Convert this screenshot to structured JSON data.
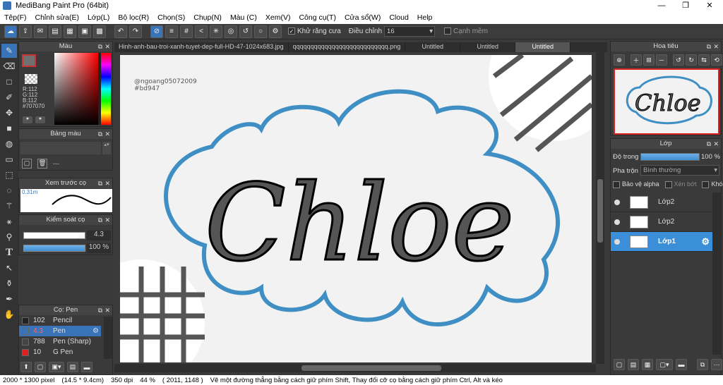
{
  "app": {
    "title": "MediBang Paint Pro (64bit)",
    "minimize": "—",
    "maximize": "❐",
    "close": "✕"
  },
  "menu": [
    "Tệp(F)",
    "Chỉnh sửa(E)",
    "Lớp(L)",
    "Bộ lọc(R)",
    "Chọn(S)",
    "Chụp(N)",
    "Màu (C)",
    "Xem(V)",
    "Công cụ(T)",
    "Cửa sổ(W)",
    "Cloud",
    "Help"
  ],
  "toolbar": {
    "antialias_label": "Khử răng cưa",
    "correction_label": "Điều chỉnh",
    "correction_value": "16",
    "edge_label": "Cạnh mềm"
  },
  "doc_tabs": [
    "Hinh-anh-bau-troi-xanh-tuyet-dep-full-HD-47-1024x683.jpg",
    "qqqqqqqqqqqqqqqqqqqqqqqqqqq.png",
    "Untitled",
    "Untitled",
    "Untitled"
  ],
  "color_panel": {
    "title": "Màu",
    "r": "R:112",
    "g": "G:112",
    "b": "B:112",
    "hex": "#707070",
    "primary": "#707070"
  },
  "palette_panel": {
    "title": "Bảng màu",
    "dash": "---"
  },
  "preview_panel": {
    "title": "Xem trước cọ",
    "size": "0.31m"
  },
  "brush_control": {
    "title": "Kiểm soát cọ",
    "size_value": "4.3",
    "opacity_value": "100 %",
    "size_fraction": 0.9,
    "opacity_fraction": 1.0
  },
  "brush_list": {
    "title": "Cọ: Pen",
    "items": [
      {
        "size": "102",
        "name": "Pencil",
        "color": "#222222",
        "selected": false
      },
      {
        "size": "4.3",
        "name": "Pen",
        "color": "#3a74b8",
        "selected": true
      },
      {
        "size": "788",
        "name": "Pen (Sharp)",
        "color": "#444444",
        "selected": false
      },
      {
        "size": "10",
        "name": "G Pen",
        "color": "#e02020",
        "selected": false
      }
    ]
  },
  "navigator": {
    "title": "Hoa tiêu"
  },
  "layers": {
    "title": "Lớp",
    "opacity_label": "Độ trong",
    "opacity_value": "100 %",
    "opacity_fraction": 1.0,
    "blend_label": "Pha trộn",
    "blend_value": "Bình thường",
    "protect_alpha": "Bảo vệ alpha",
    "clip": "Xén bớt",
    "lock": "Khóa",
    "items": [
      {
        "name": "Lớp2",
        "selected": false
      },
      {
        "name": "Lớp2",
        "selected": false
      },
      {
        "name": "Lớp1",
        "selected": true
      }
    ]
  },
  "canvas": {
    "signature_line1": "@ngoang05072009",
    "signature_line2": "#bd947",
    "text": "Chloe"
  },
  "status": {
    "size": "2000 * 1300 pixel",
    "cm": "(14.5 * 9.4cm)",
    "dpi": "350 dpi",
    "zoom": "44 %",
    "coords": "( 2011, 1148 )",
    "hint": "Vẽ một đường thẳng bằng cách giữ phím Shift, Thay đổi cỡ cọ bằng cách giữ phím Ctrl, Alt và kéo"
  }
}
